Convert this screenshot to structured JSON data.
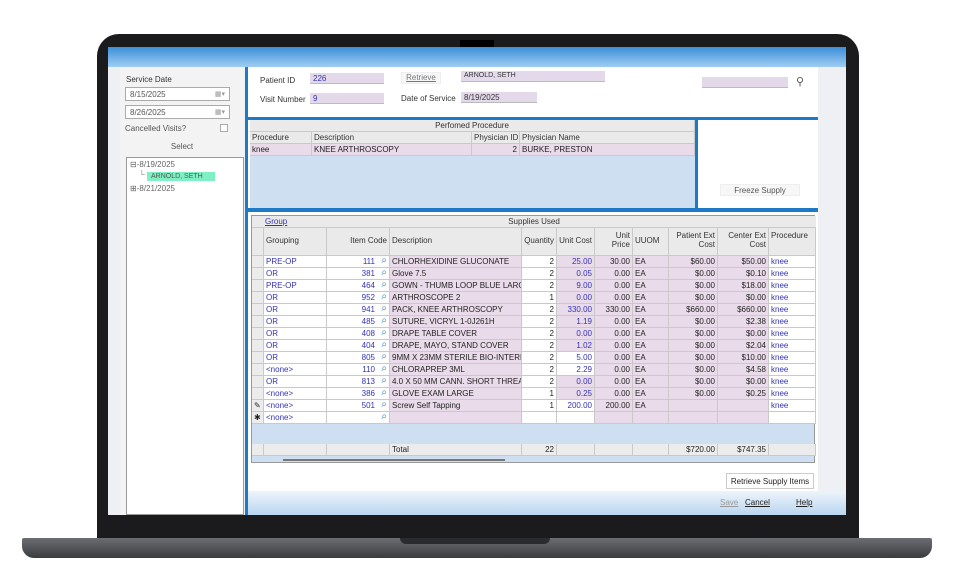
{
  "left_panel": {
    "service_date_label": "Service Date",
    "date_from": "8/15/2025",
    "date_to": "8/26/2025",
    "cancelled_visits_label": "Cancelled Visits?",
    "cancelled_visits_checked": false,
    "select_label": "Select",
    "tree": [
      {
        "label": "8/19/2025",
        "expanded": true,
        "children": [
          "ARNOLD, SETH"
        ]
      },
      {
        "label": "8/21/2025",
        "expanded": false,
        "children": []
      }
    ]
  },
  "header": {
    "patient_id_label": "Patient ID",
    "patient_id": "226",
    "visit_number_label": "Visit Number",
    "visit_number": "9",
    "retrieve_label": "Retrieve",
    "patient_name": "ARNOLD, SETH",
    "date_of_service_label": "Date of Service",
    "date_of_service": "8/19/2025",
    "search_value": ""
  },
  "performed_procedure": {
    "title": "Perfomed Procedure",
    "columns": [
      "Procedure",
      "Description",
      "Physician ID",
      "Physician Name"
    ],
    "rows": [
      [
        "knee",
        "KNEE ARTHROSCOPY",
        "2",
        "BURKE, PRESTON"
      ]
    ]
  },
  "freeze_supply_label": "Freeze Supply",
  "supplies": {
    "group_link": "Group",
    "title": "Supplies Used",
    "columns": [
      "Grouping",
      "Item Code",
      "Description",
      "Quantity",
      "Unit Cost",
      "Unit Price",
      "UUOM",
      "Patient Ext Cost",
      "Center Ext Cost",
      "Procedure"
    ],
    "rows": [
      [
        "PRE-OP",
        "111",
        "CHLORHEXIDINE GLUCONATE",
        "2",
        "25.00",
        "30.00",
        "EA",
        "$60.00",
        "$50.00",
        "knee"
      ],
      [
        "OR",
        "381",
        "Glove 7.5",
        "2",
        "0.05",
        "0.00",
        "EA",
        "$0.00",
        "$0.10",
        "knee"
      ],
      [
        "PRE-OP",
        "464",
        "GOWN - THUMB LOOP BLUE LARG",
        "2",
        "9.00",
        "0.00",
        "EA",
        "$0.00",
        "$18.00",
        "knee"
      ],
      [
        "OR",
        "952",
        "ARTHROSCOPE 2",
        "1",
        "0.00",
        "0.00",
        "EA",
        "$0.00",
        "$0.00",
        "knee"
      ],
      [
        "OR",
        "941",
        "PACK, KNEE ARTHROSCOPY",
        "2",
        "330.00",
        "330.00",
        "EA",
        "$660.00",
        "$660.00",
        "knee"
      ],
      [
        "OR",
        "485",
        "SUTURE, VICRYL 1-0J261H",
        "2",
        "1.19",
        "0.00",
        "EA",
        "$0.00",
        "$2.38",
        "knee"
      ],
      [
        "OR",
        "408",
        "DRAPE TABLE COVER",
        "2",
        "0.00",
        "0.00",
        "EA",
        "$0.00",
        "$0.00",
        "knee"
      ],
      [
        "OR",
        "404",
        "DRAPE, MAYO, STAND COVER",
        "2",
        "1.02",
        "0.00",
        "EA",
        "$0.00",
        "$2.04",
        "knee"
      ],
      [
        "OR",
        "805",
        "9MM X 23MM STERILE BIO-INTERF",
        "2",
        "5.00",
        "0.00",
        "EA",
        "$0.00",
        "$10.00",
        "knee"
      ],
      [
        "<none>",
        "110",
        "CHLORAPREP 3ML",
        "2",
        "2.29",
        "0.00",
        "EA",
        "$0.00",
        "$4.58",
        "knee"
      ],
      [
        "OR",
        "813",
        "4.0 X 50 MM CANN. SHORT THREA",
        "2",
        "0.00",
        "0.00",
        "EA",
        "$0.00",
        "$0.00",
        "knee"
      ],
      [
        "<none>",
        "386",
        "GLOVE EXAM LARGE",
        "1",
        "0.25",
        "0.00",
        "EA",
        "$0.00",
        "$0.25",
        "knee"
      ],
      [
        "<none>",
        "501",
        "Screw Self Tapping",
        "1",
        "200.00",
        "200.00",
        "EA",
        "",
        "",
        "knee"
      ],
      [
        "<none>",
        "",
        "",
        "",
        "",
        "",
        "",
        "",
        "",
        ""
      ]
    ],
    "total_label": "Total",
    "total_quantity": "22",
    "total_patient": "$720.00",
    "total_center": "$747.35"
  },
  "retrieve_supply_items_label": "Retrieve Supply Items",
  "footer": {
    "save": "Save",
    "cancel": "Cancel",
    "help": "Help"
  },
  "colors": {
    "accent": "#1e7ac4",
    "readonly_field": "#e4d9ea",
    "selected_tree": "#7ff0c4",
    "link": "#3333b8"
  }
}
